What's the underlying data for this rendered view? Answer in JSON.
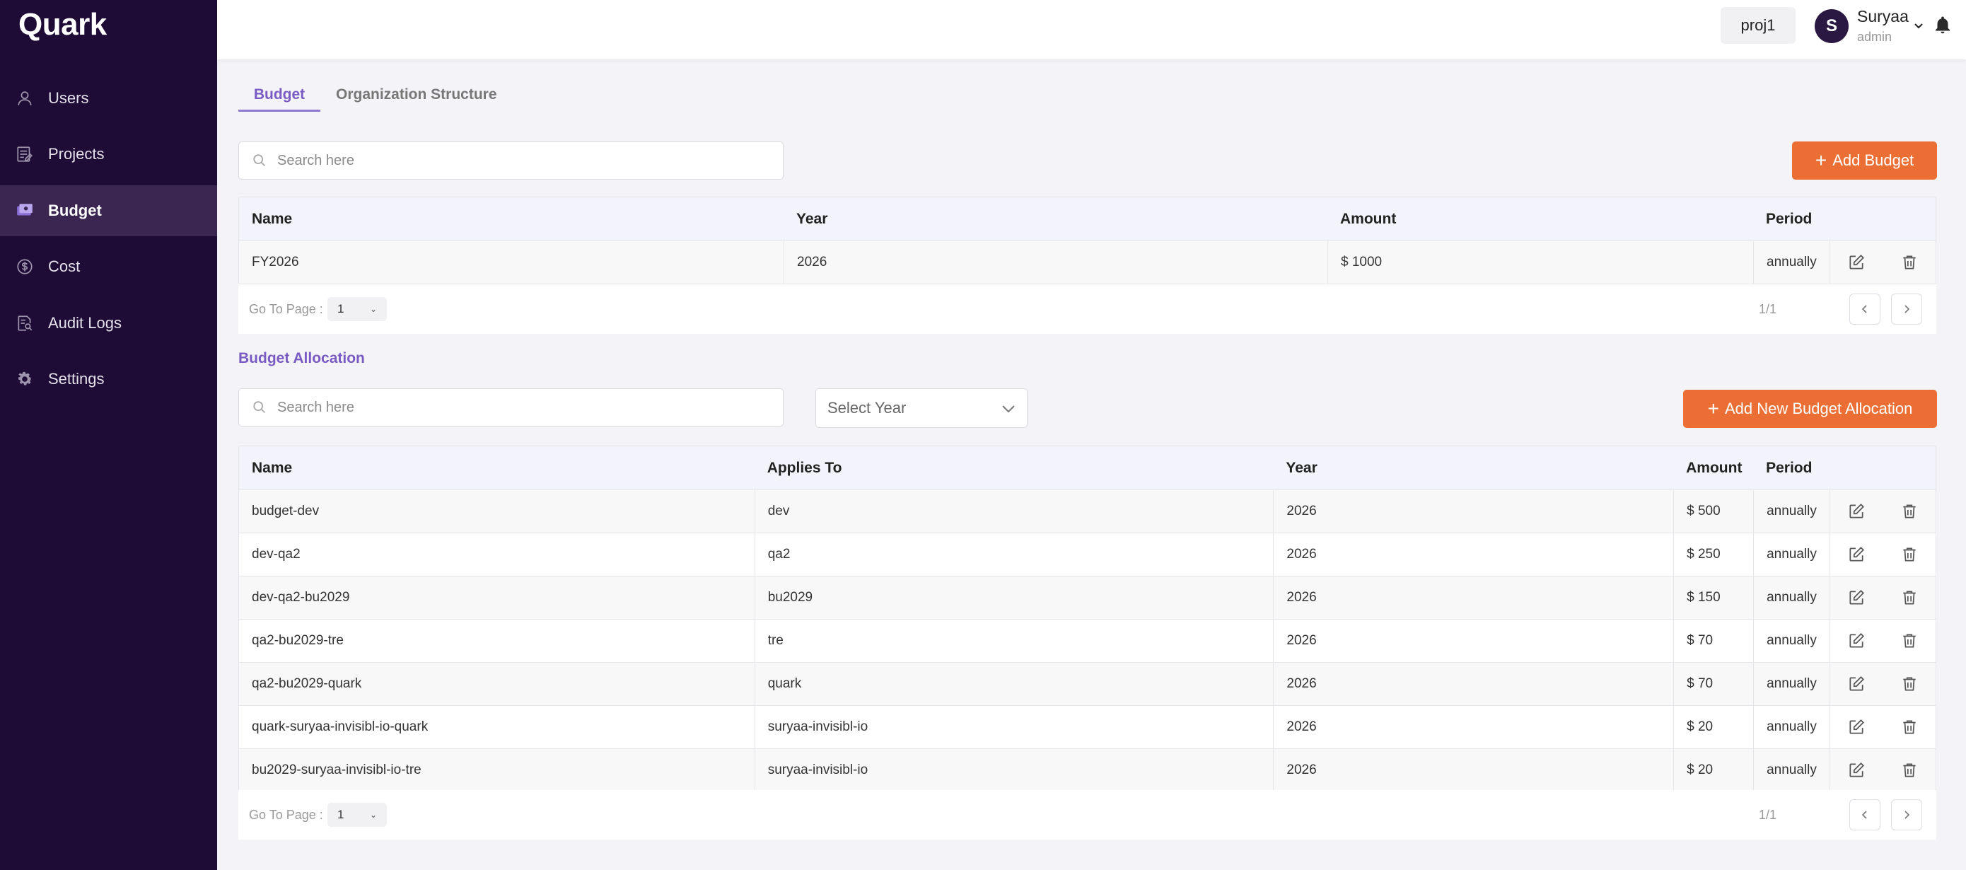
{
  "app": {
    "name": "Quark"
  },
  "sidebar": {
    "items": [
      {
        "label": "Users",
        "icon": "user-icon"
      },
      {
        "label": "Projects",
        "icon": "projects-icon"
      },
      {
        "label": "Budget",
        "icon": "budget-icon",
        "active": true
      },
      {
        "label": "Cost",
        "icon": "dollar-icon"
      },
      {
        "label": "Audit Logs",
        "icon": "audit-icon"
      },
      {
        "label": "Settings",
        "icon": "gear-icon"
      }
    ]
  },
  "header": {
    "project": "proj1",
    "user": {
      "initial": "S",
      "name": "Suryaa",
      "role": "admin"
    }
  },
  "tabs": [
    {
      "label": "Budget",
      "active": true
    },
    {
      "label": "Organization Structure"
    }
  ],
  "budget": {
    "search_placeholder": "Search here",
    "add_label": "Add Budget",
    "columns": [
      "Name",
      "Year",
      "Amount",
      "Period"
    ],
    "rows": [
      {
        "name": "FY2026",
        "year": "2026",
        "amount": "$ 1000",
        "period": "annually"
      }
    ],
    "pager": {
      "label": "Go To Page :",
      "page": "1",
      "count": "1/1"
    }
  },
  "allocation": {
    "title": "Budget Allocation",
    "search_placeholder": "Search here",
    "year_placeholder": "Select Year",
    "add_label": "Add New Budget Allocation",
    "columns": [
      "Name",
      "Applies To",
      "Year",
      "Amount",
      "Period"
    ],
    "rows": [
      {
        "name": "budget-dev",
        "applies_to": "dev",
        "year": "2026",
        "amount": "$ 500",
        "period": "annually"
      },
      {
        "name": "dev-qa2",
        "applies_to": "qa2",
        "year": "2026",
        "amount": "$ 250",
        "period": "annually"
      },
      {
        "name": "dev-qa2-bu2029",
        "applies_to": "bu2029",
        "year": "2026",
        "amount": "$ 150",
        "period": "annually"
      },
      {
        "name": "qa2-bu2029-tre",
        "applies_to": "tre",
        "year": "2026",
        "amount": "$ 70",
        "period": "annually"
      },
      {
        "name": "qa2-bu2029-quark",
        "applies_to": "quark",
        "year": "2026",
        "amount": "$ 70",
        "period": "annually"
      },
      {
        "name": "quark-suryaa-invisibl-io-quark",
        "applies_to": "suryaa-invisibl-io",
        "year": "2026",
        "amount": "$ 20",
        "period": "annually"
      },
      {
        "name": "bu2029-suryaa-invisibl-io-tre",
        "applies_to": "suryaa-invisibl-io",
        "year": "2026",
        "amount": "$ 20",
        "period": "annually"
      }
    ],
    "pager": {
      "label": "Go To Page :",
      "page": "1",
      "count": "1/1"
    }
  },
  "colors": {
    "sidebar": "#1f0c36",
    "accent": "#7a5bc4",
    "button": "#eb6f34"
  }
}
